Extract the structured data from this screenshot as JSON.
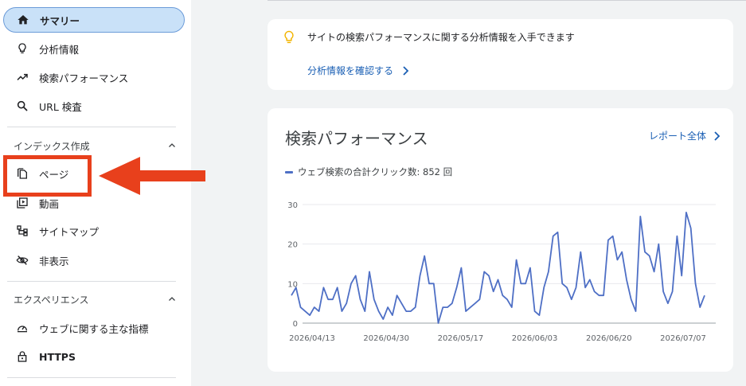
{
  "sidebar": {
    "items": [
      {
        "label": "サマリー",
        "icon": "home-icon"
      },
      {
        "label": "分析情報",
        "icon": "lightbulb-icon"
      },
      {
        "label": "検索パフォーマンス",
        "icon": "trending-up-icon"
      },
      {
        "label": "URL 検査",
        "icon": "search-icon"
      }
    ],
    "index_section": {
      "title": "インデックス作成",
      "items": [
        {
          "label": "ページ",
          "icon": "pages-icon"
        },
        {
          "label": "動画",
          "icon": "video-icon"
        },
        {
          "label": "サイトマップ",
          "icon": "sitemap-icon"
        },
        {
          "label": "非表示",
          "icon": "eye-off-icon"
        }
      ]
    },
    "experience_section": {
      "title": "エクスペリエンス",
      "items": [
        {
          "label": "ウェブに関する主な指標",
          "icon": "gauge-icon"
        },
        {
          "label": "HTTPS",
          "icon": "lock-icon"
        }
      ]
    }
  },
  "insights": {
    "text": "サイトの検索パフォーマンスに関する分析情報を入手できます",
    "link": "分析情報を確認する"
  },
  "performance": {
    "title": "検索パフォーマンス",
    "report_link": "レポート全体",
    "legend": "ウェブ検索の合計クリック数: 852 回"
  },
  "colors": {
    "accent": "#1a5fb4",
    "series": "#4e6fc5",
    "highlight": "#e8401c",
    "active_bg": "#c9e1f8"
  },
  "chart_data": {
    "type": "line",
    "ylim": [
      0,
      30
    ],
    "yticks": [
      0,
      10,
      20,
      30
    ],
    "xtick_labels": [
      "2026/04/13",
      "2026/04/30",
      "2026/05/17",
      "2026/06/03",
      "2026/06/20",
      "2026/07/07"
    ],
    "series": [
      {
        "name": "ウェブ検索の合計クリック数",
        "values": [
          7,
          9,
          4,
          3,
          2,
          4,
          3,
          9,
          6,
          6,
          9,
          3,
          5,
          10,
          12,
          6,
          3,
          13,
          6,
          3,
          1,
          4,
          2,
          7,
          5,
          3,
          3,
          4,
          12,
          17,
          10,
          10,
          0,
          4,
          4,
          5,
          9,
          14,
          3,
          4,
          5,
          6,
          13,
          12,
          8,
          11,
          7,
          6,
          4,
          16,
          10,
          10,
          14,
          3,
          2,
          9,
          13,
          22,
          23,
          10,
          9,
          6,
          9,
          18,
          9,
          11,
          8,
          7,
          7,
          21,
          22,
          16,
          18,
          11,
          6,
          3,
          27,
          18,
          17,
          13,
          20,
          8,
          5,
          8,
          22,
          12,
          28,
          24,
          10,
          4,
          7
        ]
      }
    ]
  }
}
